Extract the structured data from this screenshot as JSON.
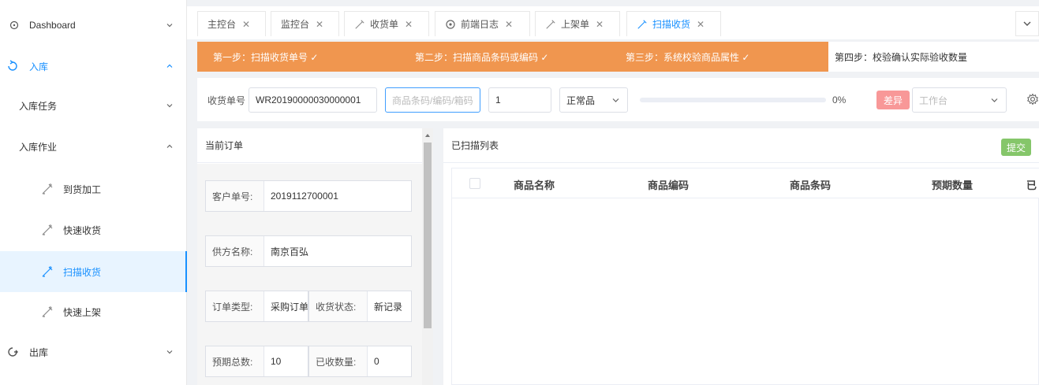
{
  "sidebar": {
    "dashboard": "Dashboard",
    "inbound": "入库",
    "inbound_task": "入库任务",
    "inbound_ops": "入库作业",
    "arrival_process": "到货加工",
    "quick_receive": "快速收货",
    "scan_receive": "扫描收货",
    "quick_shelve": "快速上架",
    "outbound": "出库"
  },
  "tabs": {
    "main": "主控台",
    "monitor": "监控台",
    "receipt": "收货单",
    "frontend_log": "前端日志",
    "shelve": "上架单",
    "scan": "扫描收货",
    "close": "✕"
  },
  "steps": {
    "step1": "第一步：扫描收货单号 ✓",
    "step2": "第二步：扫描商品条码或编码 ✓",
    "step3": "第三步：系统校验商品属性 ✓",
    "step4": "第四步：校验确认实际验收数量"
  },
  "inputs": {
    "receipt_label": "收货单号",
    "receipt_value": "WR20190000030000001",
    "barcode_placeholder": "商品条码/编码/箱码",
    "qty_value": "1",
    "quality_value": "正常品",
    "progress_pct": 0,
    "progress_label": "0%",
    "diff_button": "差异",
    "workbench_placeholder": "工作台"
  },
  "order": {
    "title": "当前订单",
    "customer_no_label": "客户单号:",
    "customer_no_value": "2019112700001",
    "supplier_label": "供方名称:",
    "supplier_value": "南京百弘",
    "order_type_label": "订单类型:",
    "order_type_value": "采购订单",
    "receive_status_label": "收货状态:",
    "receive_status_value": "新记录",
    "expected_total_label": "预期总数:",
    "expected_total_value": "10",
    "received_qty_label": "已收数量:",
    "received_qty_value": "0"
  },
  "scanned": {
    "title": "已扫描列表",
    "submit_button": "提交",
    "columns": [
      "商品名称",
      "商品编码",
      "商品条码",
      "预期数量",
      "已"
    ]
  },
  "colors": {
    "accent": "#1890ff",
    "steps_bg": "#f0964f",
    "diff_btn": "#f89898",
    "submit_btn": "#85c66a"
  }
}
